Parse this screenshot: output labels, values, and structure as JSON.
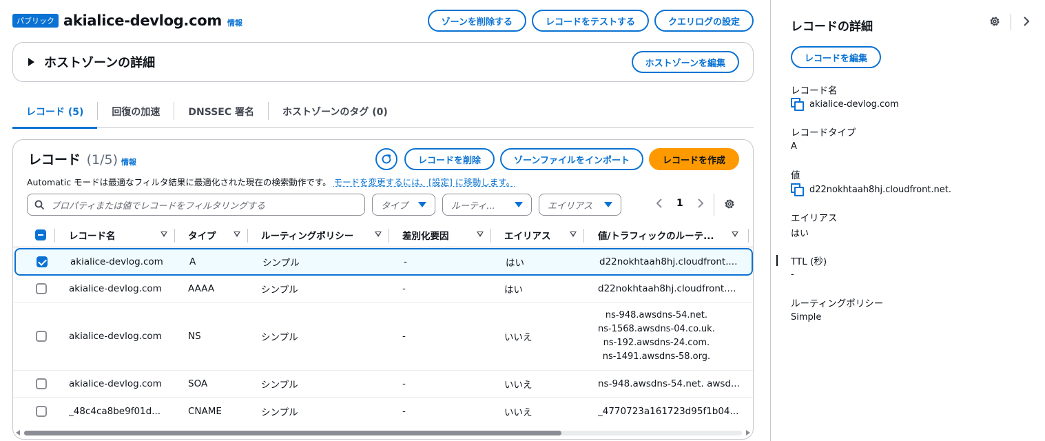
{
  "header": {
    "badge": "パブリック",
    "zone_name": "akialice-devlog.com",
    "info": "情報",
    "actions": {
      "delete_zone": "ゾーンを削除する",
      "test_record": "レコードをテストする",
      "query_log": "クエリログの設定"
    }
  },
  "hosted_zone": {
    "title": "ホストゾーンの詳細",
    "edit": "ホストゾーンを編集"
  },
  "tabs": [
    {
      "label": "レコード (5)",
      "active": true
    },
    {
      "label": "回復の加速",
      "active": false
    },
    {
      "label": "DNSSEC 署名",
      "active": false
    },
    {
      "label": "ホストゾーンのタグ (0)",
      "active": false
    }
  ],
  "records": {
    "title": "レコード",
    "count": "(1/5)",
    "info": "情報",
    "actions": {
      "delete": "レコードを削除",
      "import": "ゾーンファイルをインポート",
      "create": "レコードを作成"
    },
    "mode_note": "Automatic モードは最適なフィルタ結果に最適化された現在の検索動作です。",
    "mode_link": "モードを変更するには、[設定] に移動します。",
    "search_placeholder": "プロパティまたは値でレコードをフィルタリングする",
    "filters": {
      "type": "タイプ",
      "routing": "ルーティ...",
      "alias": "エイリアス"
    },
    "page": "1",
    "columns": [
      "レコード名",
      "タイプ",
      "ルーティングポリシー",
      "差別化要因",
      "エイリアス",
      "値/トラフィックのルーテ..."
    ],
    "rows": [
      {
        "name": "akialice-devlog.com",
        "type": "A",
        "routing": "シンプル",
        "diff": "-",
        "alias": "はい",
        "value": [
          "d22nokhtaah8hj.cloudfront...."
        ],
        "selected": true
      },
      {
        "name": "akialice-devlog.com",
        "type": "AAAA",
        "routing": "シンプル",
        "diff": "-",
        "alias": "はい",
        "value": [
          "d22nokhtaah8hj.cloudfront...."
        ],
        "selected": false
      },
      {
        "name": "akialice-devlog.com",
        "type": "NS",
        "routing": "シンプル",
        "diff": "-",
        "alias": "いいえ",
        "value": [
          "ns-948.awsdns-54.net.",
          "ns-1568.awsdns-04.co.uk.",
          "ns-192.awsdns-24.com.",
          "ns-1491.awsdns-58.org."
        ],
        "selected": false
      },
      {
        "name": "akialice-devlog.com",
        "type": "SOA",
        "routing": "シンプル",
        "diff": "-",
        "alias": "いいえ",
        "value": [
          "ns-948.awsdns-54.net. awsd..."
        ],
        "selected": false
      },
      {
        "name": "_48c4ca8be9f01d...",
        "type": "CNAME",
        "routing": "シンプル",
        "diff": "-",
        "alias": "いいえ",
        "value": [
          "_4770723a161723d95f1b04..."
        ],
        "selected": false
      }
    ]
  },
  "detail": {
    "title": "レコードの詳細",
    "edit": "レコードを編集",
    "fields": {
      "record_name_label": "レコード名",
      "record_name": "akialice-devlog.com",
      "record_type_label": "レコードタイプ",
      "record_type": "A",
      "value_label": "値",
      "value": "d22nokhtaah8hj.cloudfront.net.",
      "alias_label": "エイリアス",
      "alias": "はい",
      "ttl_label": "TTL (秒)",
      "ttl": "-",
      "routing_label": "ルーティングポリシー",
      "routing": "Simple"
    }
  },
  "colors": {
    "accent": "#0972d3",
    "primary_button": "#ff9900",
    "border": "#c6c6cd",
    "selected_row_bg": "#f0fbff"
  },
  "icons": {
    "refresh": "refresh-icon",
    "search": "search-icon",
    "gear": "gear-icon",
    "copy": "copy-icon",
    "close": "chevron-right-icon"
  }
}
